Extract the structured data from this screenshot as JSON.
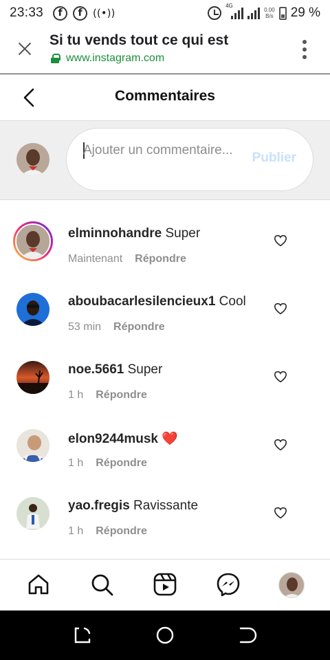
{
  "status_bar": {
    "time": "23:33",
    "network": "4G",
    "speed_top": "0.00",
    "speed_bottom": "B/s",
    "battery": "29 %"
  },
  "browser": {
    "page_title": "Si tu vends tout ce qui est",
    "url": "www.instagram.com"
  },
  "header": {
    "title": "Commentaires"
  },
  "composer": {
    "placeholder": "Ajouter un commentaire...",
    "publish_label": "Publier"
  },
  "comments": [
    {
      "username": "elminnohandre",
      "text": "Super",
      "time": "Maintenant",
      "reply_label": "Répondre",
      "avatar_icon": "man-portrait-avatar",
      "has_story_ring": true
    },
    {
      "username": "aboubacarlesilencieux1",
      "text": "Cool",
      "time": "53 min",
      "reply_label": "Répondre",
      "avatar_icon": "man-sunglasses-avatar",
      "has_story_ring": false
    },
    {
      "username": "noe.5661",
      "text": "Super",
      "time": "1 h",
      "reply_label": "Répondre",
      "avatar_icon": "sunset-tree-avatar",
      "has_story_ring": false
    },
    {
      "username": "elon9244musk",
      "text": "❤️",
      "time": "1 h",
      "reply_label": "Répondre",
      "avatar_icon": "man-selfie-avatar",
      "has_story_ring": false
    },
    {
      "username": "yao.fregis",
      "text": "Ravissante",
      "time": "1 h",
      "reply_label": "Répondre",
      "avatar_icon": "man-standing-avatar",
      "has_story_ring": false
    }
  ],
  "bottom_nav": [
    "home-icon",
    "search-icon",
    "reels-icon",
    "messenger-icon",
    "profile-avatar"
  ],
  "colors": {
    "publish_disabled": "#c8e1fb",
    "secure_green": "#1e8e3e",
    "composer_bg": "#efefef",
    "heart_red": "#ed2d3d"
  }
}
